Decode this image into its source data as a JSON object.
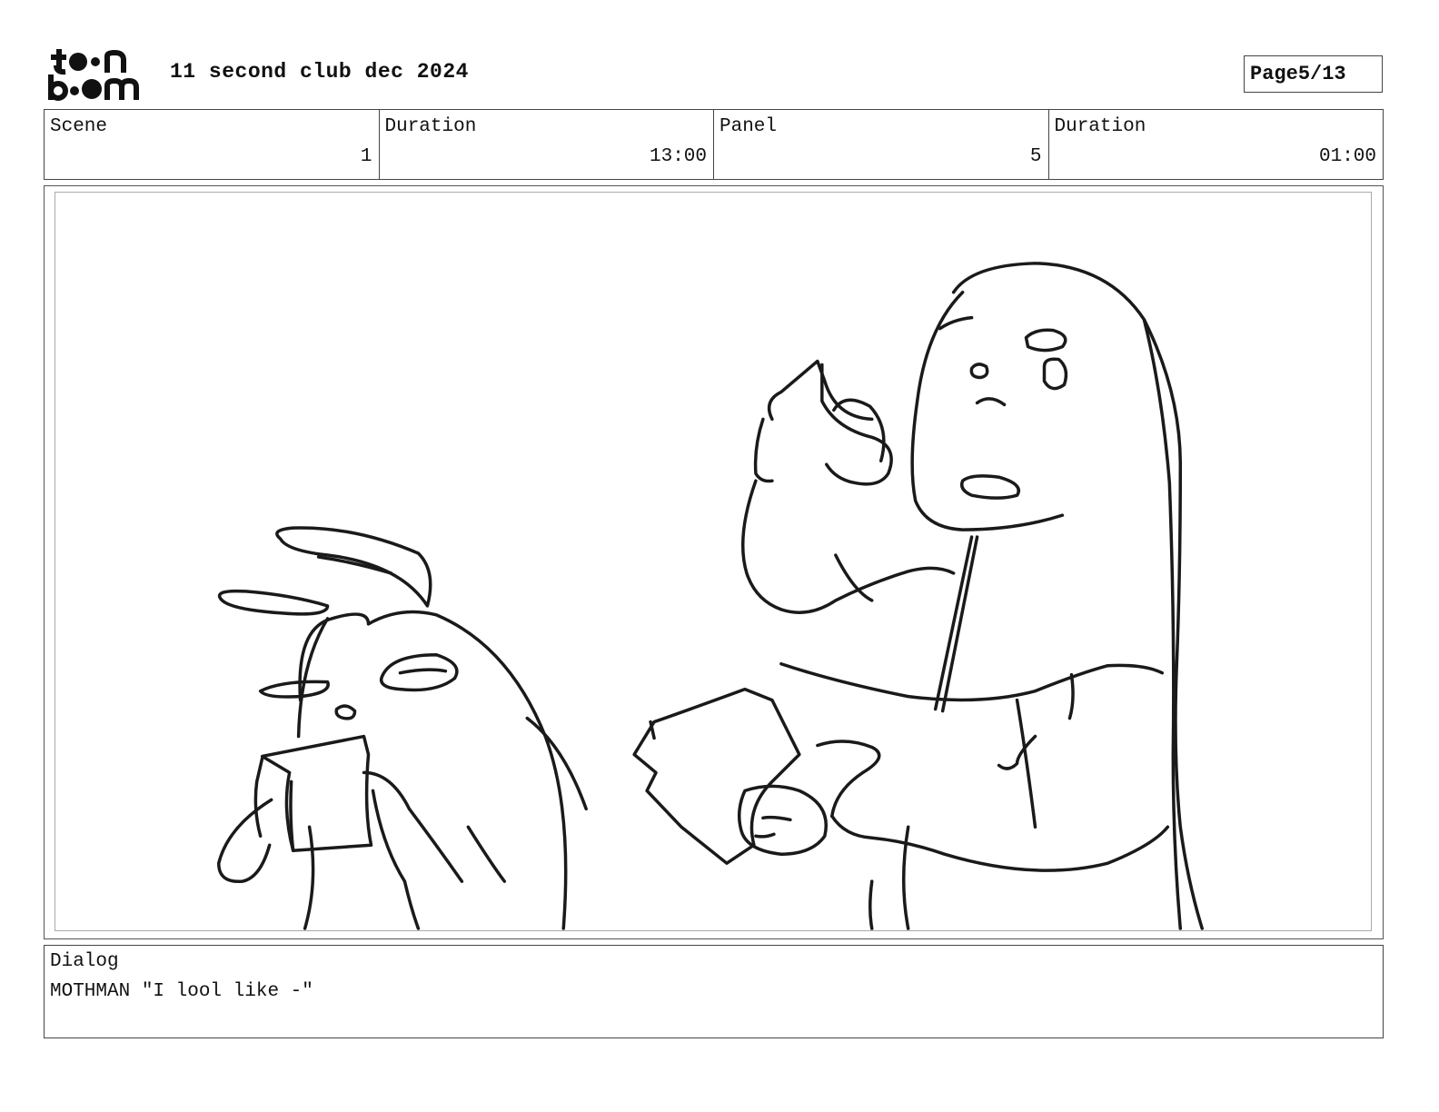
{
  "header": {
    "logo_line1": "toon",
    "logo_line2": "boom",
    "project_title": "11 second club dec 2024",
    "page_label": "Page",
    "page_value": "5/13"
  },
  "info": {
    "scene_label": "Scene",
    "scene_value": "1",
    "scene_duration_label": "Duration",
    "scene_duration_value": "13:00",
    "panel_label": "Panel",
    "panel_value": "5",
    "panel_duration_label": "Duration",
    "panel_duration_value": "01:00"
  },
  "dialog": {
    "label": "Dialog",
    "text": "MOTHMAN \"I lool like -\""
  }
}
